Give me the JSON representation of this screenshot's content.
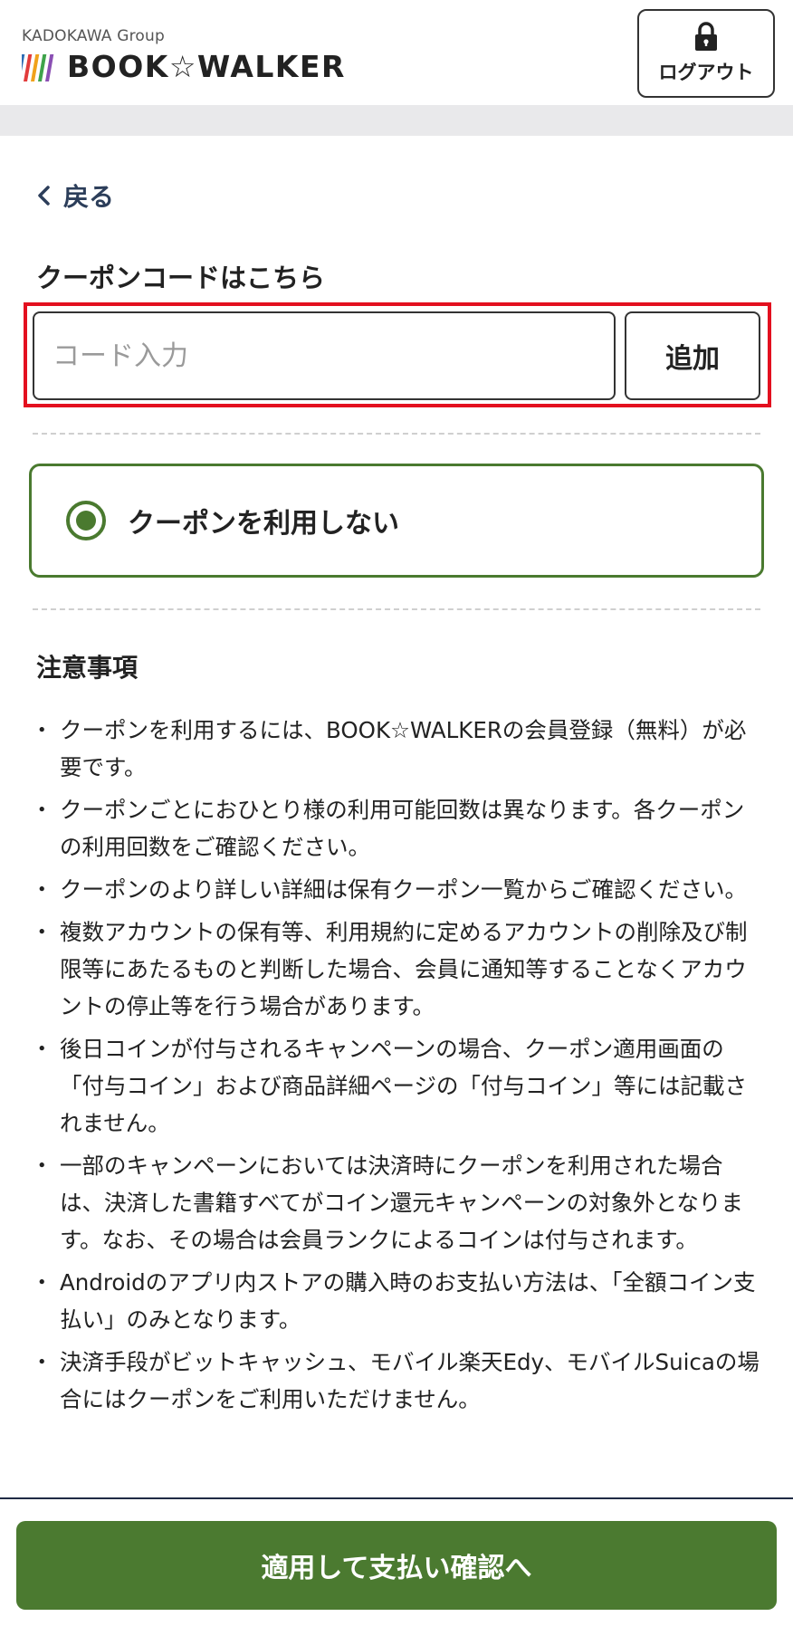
{
  "header": {
    "brand_group": "KADOKAWA Group",
    "logo_text": "BOOK☆WALKER",
    "logout_label": "ログアウト",
    "logout_icon": "lock-icon"
  },
  "nav": {
    "back_label": "戻る",
    "back_icon": "chevron-left-icon"
  },
  "coupon_code": {
    "section_title": "クーポンコードはこちら",
    "input_value": "",
    "input_placeholder": "コード入力",
    "add_label": "追加",
    "highlight_color": "#e3101f"
  },
  "coupon_option": {
    "label": "クーポンを利用しない",
    "selected": true,
    "accent_color": "#4a7a2f"
  },
  "notes": {
    "title": "注意事項",
    "items": [
      "クーポンを利用するには、BOOK☆WALKERの会員登録（無料）が必要です。",
      "クーポンごとにおひとり様の利用可能回数は異なります。各クーポンの利用回数をご確認ください。",
      "クーポンのより詳しい詳細は保有クーポン一覧からご確認ください。",
      "複数アカウントの保有等、利用規約に定めるアカウントの削除及び制限等にあたるものと判断した場合、会員に通知等することなくアカウントの停止等を行う場合があります。",
      "後日コインが付与されるキャンペーンの場合、クーポン適用画面の「付与コイン」および商品詳細ページの「付与コイン」等には記載されません。",
      "一部のキャンペーンにおいては決済時にクーポンを利用された場合は、決済した書籍すべてがコイン還元キャンペーンの対象外となります。なお、その場合は会員ランクによるコインは付与されます。",
      "Androidのアプリ内ストアの購入時のお支払い方法は、「全額コイン支払い」のみとなります。",
      "決済手段がビットキャッシュ、モバイル楽天Edy、モバイルSuicaの場合にはクーポンをご利用いただけません。"
    ]
  },
  "footer": {
    "confirm_label": "適用して支払い確認へ",
    "button_color": "#4b7a30"
  }
}
